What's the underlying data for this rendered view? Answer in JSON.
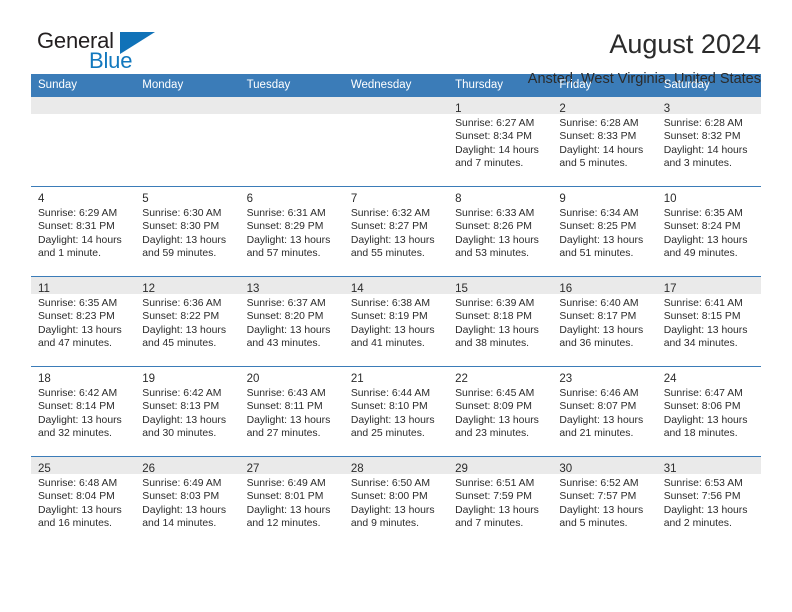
{
  "logo": {
    "word_top": "General",
    "word_bottom": "Blue",
    "triangle_color": "#1072b8",
    "text_color": "#231f20",
    "blue_color": "#1278be"
  },
  "header": {
    "title": "August 2024",
    "subtitle": "Ansted, West Virginia, United States"
  },
  "theme": {
    "header_bg": "#3b7cb8",
    "header_text": "#ffffff",
    "cell_shade": "#eaeaea",
    "grid_line": "#3b7cb8",
    "body_text": "#2b2b2b"
  },
  "weekday_headers": [
    "Sunday",
    "Monday",
    "Tuesday",
    "Wednesday",
    "Thursday",
    "Friday",
    "Saturday"
  ],
  "labels": {
    "sunrise_prefix": "Sunrise:",
    "sunset_prefix": "Sunset:",
    "daylight_prefix": "Daylight:"
  },
  "weeks": [
    [
      {
        "day": "",
        "sunrise": "",
        "sunset": "",
        "daylight_1": "",
        "daylight_2": "",
        "empty": true
      },
      {
        "day": "",
        "sunrise": "",
        "sunset": "",
        "daylight_1": "",
        "daylight_2": "",
        "empty": true
      },
      {
        "day": "",
        "sunrise": "",
        "sunset": "",
        "daylight_1": "",
        "daylight_2": "",
        "empty": true
      },
      {
        "day": "",
        "sunrise": "",
        "sunset": "",
        "daylight_1": "",
        "daylight_2": "",
        "empty": true
      },
      {
        "day": "1",
        "sunrise": "Sunrise: 6:27 AM",
        "sunset": "Sunset: 8:34 PM",
        "daylight_1": "Daylight: 14 hours",
        "daylight_2": "and 7 minutes.",
        "empty": false
      },
      {
        "day": "2",
        "sunrise": "Sunrise: 6:28 AM",
        "sunset": "Sunset: 8:33 PM",
        "daylight_1": "Daylight: 14 hours",
        "daylight_2": "and 5 minutes.",
        "empty": false
      },
      {
        "day": "3",
        "sunrise": "Sunrise: 6:28 AM",
        "sunset": "Sunset: 8:32 PM",
        "daylight_1": "Daylight: 14 hours",
        "daylight_2": "and 3 minutes.",
        "empty": false
      }
    ],
    [
      {
        "day": "4",
        "sunrise": "Sunrise: 6:29 AM",
        "sunset": "Sunset: 8:31 PM",
        "daylight_1": "Daylight: 14 hours",
        "daylight_2": "and 1 minute.",
        "empty": false
      },
      {
        "day": "5",
        "sunrise": "Sunrise: 6:30 AM",
        "sunset": "Sunset: 8:30 PM",
        "daylight_1": "Daylight: 13 hours",
        "daylight_2": "and 59 minutes.",
        "empty": false
      },
      {
        "day": "6",
        "sunrise": "Sunrise: 6:31 AM",
        "sunset": "Sunset: 8:29 PM",
        "daylight_1": "Daylight: 13 hours",
        "daylight_2": "and 57 minutes.",
        "empty": false
      },
      {
        "day": "7",
        "sunrise": "Sunrise: 6:32 AM",
        "sunset": "Sunset: 8:27 PM",
        "daylight_1": "Daylight: 13 hours",
        "daylight_2": "and 55 minutes.",
        "empty": false
      },
      {
        "day": "8",
        "sunrise": "Sunrise: 6:33 AM",
        "sunset": "Sunset: 8:26 PM",
        "daylight_1": "Daylight: 13 hours",
        "daylight_2": "and 53 minutes.",
        "empty": false
      },
      {
        "day": "9",
        "sunrise": "Sunrise: 6:34 AM",
        "sunset": "Sunset: 8:25 PM",
        "daylight_1": "Daylight: 13 hours",
        "daylight_2": "and 51 minutes.",
        "empty": false
      },
      {
        "day": "10",
        "sunrise": "Sunrise: 6:35 AM",
        "sunset": "Sunset: 8:24 PM",
        "daylight_1": "Daylight: 13 hours",
        "daylight_2": "and 49 minutes.",
        "empty": false
      }
    ],
    [
      {
        "day": "11",
        "sunrise": "Sunrise: 6:35 AM",
        "sunset": "Sunset: 8:23 PM",
        "daylight_1": "Daylight: 13 hours",
        "daylight_2": "and 47 minutes.",
        "empty": false
      },
      {
        "day": "12",
        "sunrise": "Sunrise: 6:36 AM",
        "sunset": "Sunset: 8:22 PM",
        "daylight_1": "Daylight: 13 hours",
        "daylight_2": "and 45 minutes.",
        "empty": false
      },
      {
        "day": "13",
        "sunrise": "Sunrise: 6:37 AM",
        "sunset": "Sunset: 8:20 PM",
        "daylight_1": "Daylight: 13 hours",
        "daylight_2": "and 43 minutes.",
        "empty": false
      },
      {
        "day": "14",
        "sunrise": "Sunrise: 6:38 AM",
        "sunset": "Sunset: 8:19 PM",
        "daylight_1": "Daylight: 13 hours",
        "daylight_2": "and 41 minutes.",
        "empty": false
      },
      {
        "day": "15",
        "sunrise": "Sunrise: 6:39 AM",
        "sunset": "Sunset: 8:18 PM",
        "daylight_1": "Daylight: 13 hours",
        "daylight_2": "and 38 minutes.",
        "empty": false
      },
      {
        "day": "16",
        "sunrise": "Sunrise: 6:40 AM",
        "sunset": "Sunset: 8:17 PM",
        "daylight_1": "Daylight: 13 hours",
        "daylight_2": "and 36 minutes.",
        "empty": false
      },
      {
        "day": "17",
        "sunrise": "Sunrise: 6:41 AM",
        "sunset": "Sunset: 8:15 PM",
        "daylight_1": "Daylight: 13 hours",
        "daylight_2": "and 34 minutes.",
        "empty": false
      }
    ],
    [
      {
        "day": "18",
        "sunrise": "Sunrise: 6:42 AM",
        "sunset": "Sunset: 8:14 PM",
        "daylight_1": "Daylight: 13 hours",
        "daylight_2": "and 32 minutes.",
        "empty": false
      },
      {
        "day": "19",
        "sunrise": "Sunrise: 6:42 AM",
        "sunset": "Sunset: 8:13 PM",
        "daylight_1": "Daylight: 13 hours",
        "daylight_2": "and 30 minutes.",
        "empty": false
      },
      {
        "day": "20",
        "sunrise": "Sunrise: 6:43 AM",
        "sunset": "Sunset: 8:11 PM",
        "daylight_1": "Daylight: 13 hours",
        "daylight_2": "and 27 minutes.",
        "empty": false
      },
      {
        "day": "21",
        "sunrise": "Sunrise: 6:44 AM",
        "sunset": "Sunset: 8:10 PM",
        "daylight_1": "Daylight: 13 hours",
        "daylight_2": "and 25 minutes.",
        "empty": false
      },
      {
        "day": "22",
        "sunrise": "Sunrise: 6:45 AM",
        "sunset": "Sunset: 8:09 PM",
        "daylight_1": "Daylight: 13 hours",
        "daylight_2": "and 23 minutes.",
        "empty": false
      },
      {
        "day": "23",
        "sunrise": "Sunrise: 6:46 AM",
        "sunset": "Sunset: 8:07 PM",
        "daylight_1": "Daylight: 13 hours",
        "daylight_2": "and 21 minutes.",
        "empty": false
      },
      {
        "day": "24",
        "sunrise": "Sunrise: 6:47 AM",
        "sunset": "Sunset: 8:06 PM",
        "daylight_1": "Daylight: 13 hours",
        "daylight_2": "and 18 minutes.",
        "empty": false
      }
    ],
    [
      {
        "day": "25",
        "sunrise": "Sunrise: 6:48 AM",
        "sunset": "Sunset: 8:04 PM",
        "daylight_1": "Daylight: 13 hours",
        "daylight_2": "and 16 minutes.",
        "empty": false
      },
      {
        "day": "26",
        "sunrise": "Sunrise: 6:49 AM",
        "sunset": "Sunset: 8:03 PM",
        "daylight_1": "Daylight: 13 hours",
        "daylight_2": "and 14 minutes.",
        "empty": false
      },
      {
        "day": "27",
        "sunrise": "Sunrise: 6:49 AM",
        "sunset": "Sunset: 8:01 PM",
        "daylight_1": "Daylight: 13 hours",
        "daylight_2": "and 12 minutes.",
        "empty": false
      },
      {
        "day": "28",
        "sunrise": "Sunrise: 6:50 AM",
        "sunset": "Sunset: 8:00 PM",
        "daylight_1": "Daylight: 13 hours",
        "daylight_2": "and 9 minutes.",
        "empty": false
      },
      {
        "day": "29",
        "sunrise": "Sunrise: 6:51 AM",
        "sunset": "Sunset: 7:59 PM",
        "daylight_1": "Daylight: 13 hours",
        "daylight_2": "and 7 minutes.",
        "empty": false
      },
      {
        "day": "30",
        "sunrise": "Sunrise: 6:52 AM",
        "sunset": "Sunset: 7:57 PM",
        "daylight_1": "Daylight: 13 hours",
        "daylight_2": "and 5 minutes.",
        "empty": false
      },
      {
        "day": "31",
        "sunrise": "Sunrise: 6:53 AM",
        "sunset": "Sunset: 7:56 PM",
        "daylight_1": "Daylight: 13 hours",
        "daylight_2": "and 2 minutes.",
        "empty": false
      }
    ]
  ]
}
